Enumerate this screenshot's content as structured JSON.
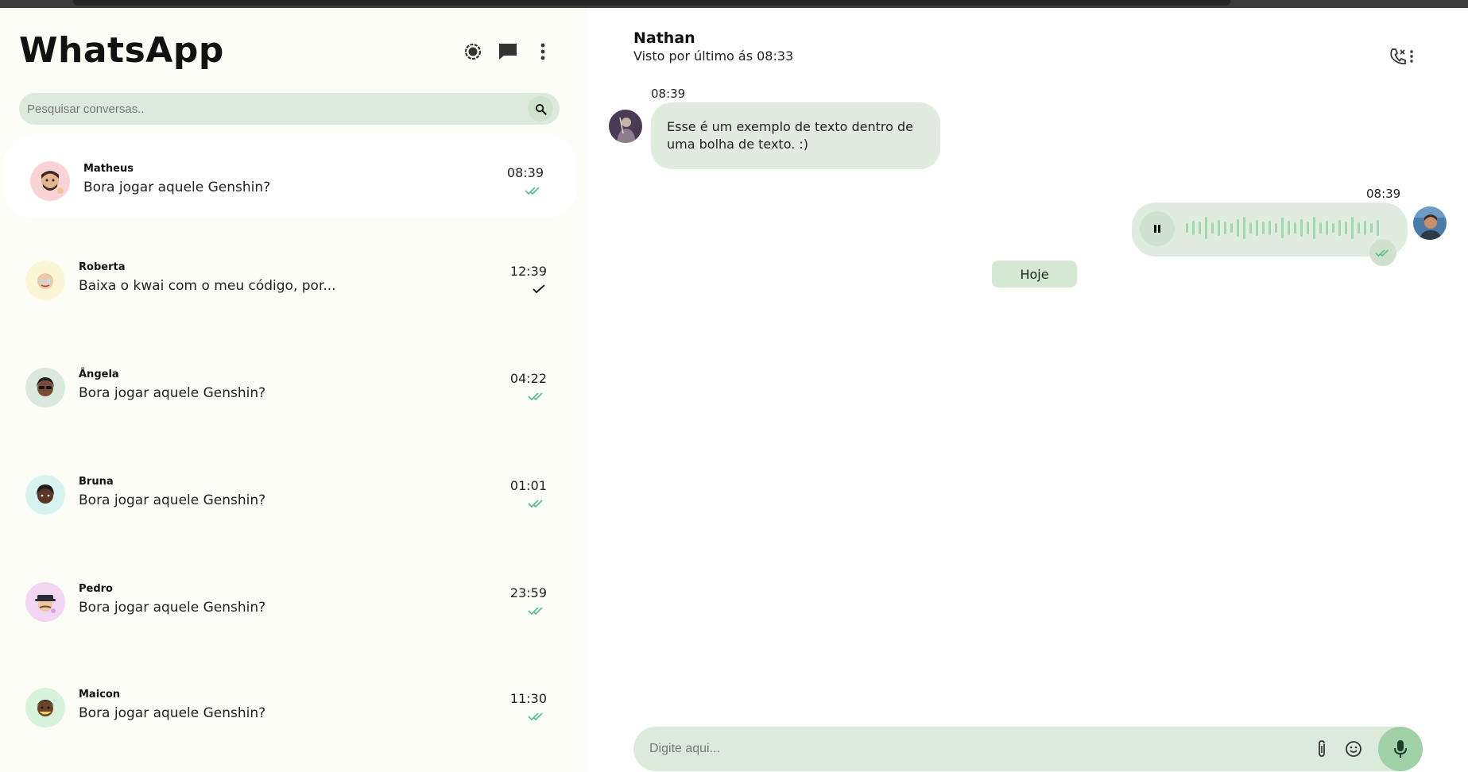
{
  "app": {
    "title": "WhatsApp"
  },
  "sidebar": {
    "header_icons": [
      "status-icon",
      "new-chat-icon",
      "menu-dots-icon"
    ],
    "search": {
      "placeholder": "Pesquisar conversas..",
      "value": ""
    },
    "chats": [
      {
        "name": "Matheus",
        "message": "Bora jogar aquele Genshin?",
        "time": "08:39",
        "status": "read",
        "avatar_bg": "#f9d3d6"
      },
      {
        "name": "Roberta",
        "message": "Baixa o kwai com o meu código, por...",
        "time": "12:39",
        "status": "sent",
        "avatar_bg": "#fbf6d6"
      },
      {
        "name": "Ângela",
        "message": "Bora jogar aquele Genshin?",
        "time": "04:22",
        "status": "read",
        "avatar_bg": "#dbe8dc"
      },
      {
        "name": "Bruna",
        "message": "Bora jogar aquele Genshin?",
        "time": "01:01",
        "status": "read",
        "avatar_bg": "#d7f3ef"
      },
      {
        "name": "Pedro",
        "message": "Bora jogar aquele Genshin?",
        "time": "23:59",
        "status": "read",
        "avatar_bg": "#f3d6f3"
      },
      {
        "name": "Maicon",
        "message": "Bora jogar aquele Genshin?",
        "time": "11:30",
        "status": "read",
        "avatar_bg": "#d7f3dc"
      }
    ]
  },
  "conversation": {
    "contact_name": "Nathan",
    "contact_status": "Visto por último ás 08:33",
    "header_icons": [
      "call-icon",
      "menu-dots-icon"
    ],
    "incoming": {
      "time": "08:39",
      "text": "Esse é um exemplo de texto dentro de uma bolha de texto. :)"
    },
    "outgoing_audio": {
      "time": "08:39",
      "status": "read"
    },
    "day_chip": "Hoje",
    "composer": {
      "placeholder": "Digite aqui...",
      "value": ""
    }
  },
  "colors": {
    "accent": "#dbeadb",
    "check_read": "#5fbf8f",
    "mic": "#9fd0a6"
  }
}
